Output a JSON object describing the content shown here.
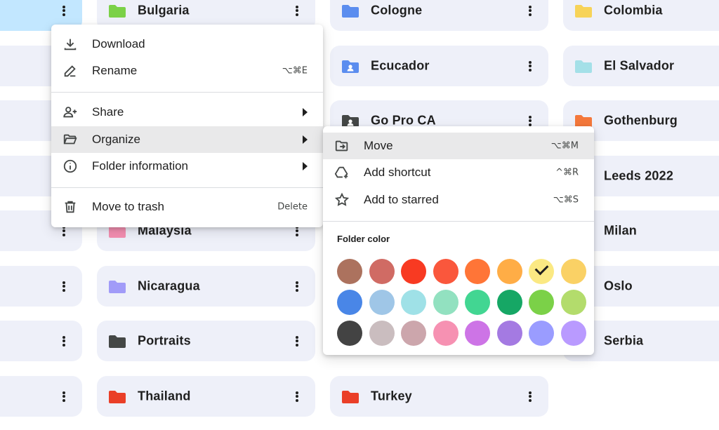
{
  "tiles": [
    {
      "name": "",
      "color": "#c2e7ff",
      "selected": true
    },
    {
      "name": "Bulgaria",
      "color": "#7bd148"
    },
    {
      "name": "Cologne",
      "color": "#5b8def"
    },
    {
      "name": "Colombia",
      "color": "#f7d358"
    },
    {
      "name": "Ecucador",
      "color": "#5b8def"
    },
    {
      "name": "El Salvador",
      "color": "#a4e0e8"
    },
    {
      "name": "Go Pro CA",
      "color": "#444746"
    },
    {
      "name": "Gothenburg",
      "color": "#f4783b"
    },
    {
      "name": "Leeds 2022",
      "color": "#f7d358"
    },
    {
      "name": "Malaysia",
      "color": "#f48fb1"
    },
    {
      "name": "Milan",
      "color": "#9e9e9e"
    },
    {
      "name": "Nicaragua",
      "color": "#a19bf8"
    },
    {
      "name": "Oslo",
      "color": "#9e9e9e"
    },
    {
      "name": "Portraits",
      "color": "#444746"
    },
    {
      "name": "Serbia",
      "color": "#9e9e9e"
    },
    {
      "name": "Thailand",
      "color": "#ea3f28"
    },
    {
      "name": "Turkey",
      "color": "#ea3f28"
    }
  ],
  "context_menu": {
    "download": "Download",
    "rename": "Rename",
    "rename_shortcut": "⌥⌘E",
    "share": "Share",
    "organize": "Organize",
    "folder_information": "Folder information",
    "move_to_trash": "Move to trash",
    "move_to_trash_shortcut": "Delete"
  },
  "organize_menu": {
    "move": "Move",
    "move_shortcut": "⌥⌘M",
    "add_shortcut": "Add shortcut",
    "add_shortcut_shortcut": "^⌘R",
    "add_to_starred": "Add to starred",
    "add_to_starred_shortcut": "⌥⌘S",
    "folder_color_label": "Folder color"
  },
  "folder_colors": [
    "#ac725e",
    "#d06b64",
    "#f83a22",
    "#fa573c",
    "#ff7537",
    "#ffad46",
    "#fbe983",
    "#fad165",
    "#4986e7",
    "#9fc6e7",
    "#9fe1e7",
    "#92e1c0",
    "#42d692",
    "#16a765",
    "#7bd148",
    "#b3dc6c",
    "#434343",
    "#cabdbf",
    "#cca6ac",
    "#f691b2",
    "#cd74e6",
    "#a47ae2",
    "#9a9cff",
    "#b99aff"
  ],
  "selected_color": "#fbe983",
  "icons": [
    "folder-icon",
    "more-vert-icon",
    "download-icon",
    "rename-icon",
    "share-icon",
    "folder-open-icon",
    "info-icon",
    "trash-icon",
    "chevron-right-icon",
    "move-icon",
    "add-shortcut-icon",
    "star-icon",
    "checkmark-icon"
  ]
}
